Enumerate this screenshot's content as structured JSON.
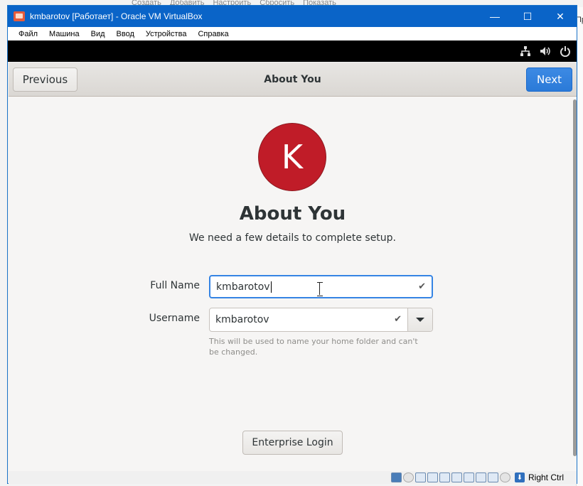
{
  "host": {
    "menu": [
      "Создать",
      "Добавить",
      "Настроить",
      "Сбросить",
      "Показать"
    ],
    "right_label": "Пр"
  },
  "window": {
    "title": "kmbarotov [Работает] - Oracle VM VirtualBox",
    "controls": {
      "minimize": "—",
      "maximize": "☐",
      "close": "✕"
    }
  },
  "menubar": {
    "items": [
      "Файл",
      "Машина",
      "Вид",
      "Ввод",
      "Устройства",
      "Справка"
    ]
  },
  "vm_tray": {
    "icons": [
      "network-icon",
      "volume-icon",
      "power-icon"
    ]
  },
  "setup": {
    "header": {
      "previous_label": "Previous",
      "title": "About You",
      "next_label": "Next"
    },
    "avatar_letter": "K",
    "avatar_color": "#c01c28",
    "heading": "About You",
    "subtitle": "We need a few details to complete setup.",
    "full_name": {
      "label": "Full Name",
      "value": "kmbarotov"
    },
    "username": {
      "label": "Username",
      "value": "kmbarotov"
    },
    "hint": "This will be used to name your home folder and can't be changed.",
    "enterprise_label": "Enterprise Login",
    "accent_color": "#3584e4"
  },
  "statusbar": {
    "host_key": "Right Ctrl"
  }
}
